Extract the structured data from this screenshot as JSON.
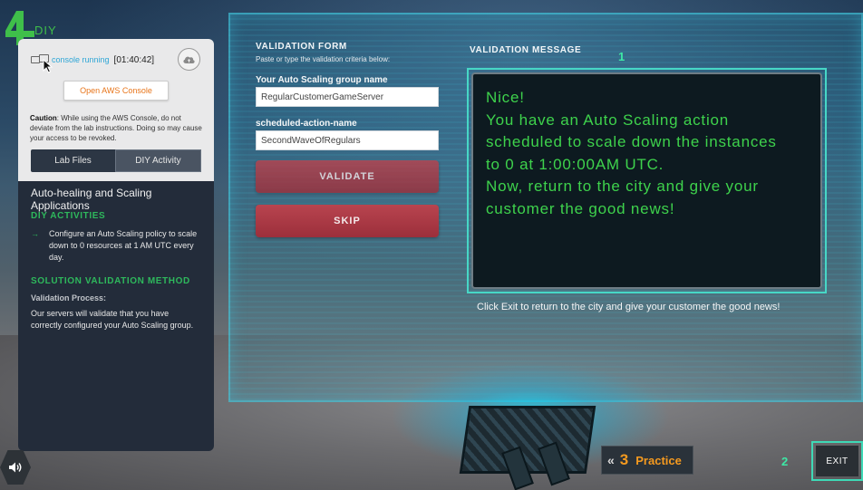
{
  "brand": {
    "logo_text": "DIY",
    "logo_color": "#3fbf4a"
  },
  "console": {
    "status": "console running",
    "timer": "[01:40:42]",
    "open_button": "Open AWS Console",
    "caution_label": "Caution",
    "caution_text": ": While using the AWS Console, do not deviate from the lab instructions. Doing so may cause your access to be revoked."
  },
  "tabs": [
    {
      "label": "Lab Files",
      "active": false
    },
    {
      "label": "DIY Activity",
      "active": true
    }
  ],
  "left_panel": {
    "title": "Auto-healing and Scaling Applications",
    "activities_heading": "DIY ACTIVITIES",
    "activity_item": "Configure an Auto Scaling policy to scale down to 0 resources at 1 AM UTC every day.",
    "solution_heading": "SOLUTION VALIDATION METHOD",
    "validation_process_label": "Validation Process:",
    "validation_process_text": "Our servers will validate that you have correctly configured your Auto Scaling group."
  },
  "form": {
    "title": "VALIDATION FORM",
    "subtitle": "Paste or type the validation criteria below:",
    "field1_label": "Your Auto Scaling group name",
    "field1_value": "RegularCustomerGameServer",
    "field2_label": "scheduled-action-name",
    "field2_value": "SecondWaveOfRegulars",
    "validate_label": "VALIDATE",
    "skip_label": "SKIP"
  },
  "validation": {
    "title": "VALIDATION MESSAGE",
    "badge": "1",
    "lines": [
      "Nice!",
      "You have an Auto Scaling action",
      "scheduled to scale down the instances",
      "to 0 at 1:00:00AM UTC.",
      "Now, return to the city and give your",
      "customer the good news!"
    ],
    "footer": "Click Exit to return to the city and give your customer the good news!",
    "text_color": "#3ed24c"
  },
  "bottom": {
    "practice_number": "3",
    "practice_label": "Practice",
    "exit_badge": "2",
    "exit_label": "EXIT"
  }
}
